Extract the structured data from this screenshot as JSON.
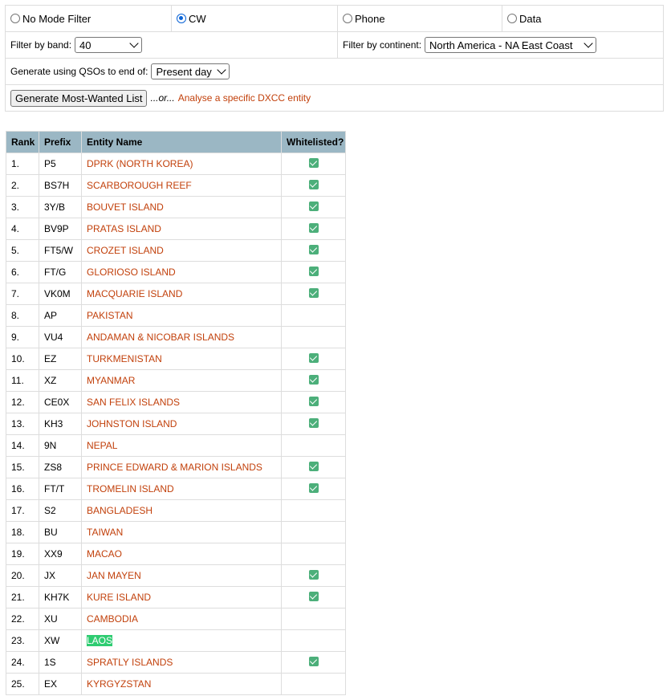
{
  "mode_filter": {
    "options": [
      {
        "label": "No Mode Filter",
        "checked": false
      },
      {
        "label": "CW",
        "checked": true
      },
      {
        "label": "Phone",
        "checked": false
      },
      {
        "label": "Data",
        "checked": false
      }
    ]
  },
  "band_filter": {
    "label": "Filter by band:",
    "value": "40"
  },
  "continent_filter": {
    "label": "Filter by continent:",
    "value": "North America - NA East Coast"
  },
  "date_filter": {
    "label": "Generate using QSOs to end of:",
    "value": "Present day"
  },
  "actions": {
    "generate_label": "Generate Most-Wanted List",
    "or_text": "...or...",
    "analyse_link": "Analyse a specific DXCC entity"
  },
  "table": {
    "headers": [
      "Rank",
      "Prefix",
      "Entity Name",
      "Whitelisted?"
    ],
    "rows": [
      {
        "rank": "1.",
        "prefix": "P5",
        "entity": "DPRK (NORTH KOREA)",
        "whitelisted": true
      },
      {
        "rank": "2.",
        "prefix": "BS7H",
        "entity": "SCARBOROUGH REEF",
        "whitelisted": true
      },
      {
        "rank": "3.",
        "prefix": "3Y/B",
        "entity": "BOUVET ISLAND",
        "whitelisted": true
      },
      {
        "rank": "4.",
        "prefix": "BV9P",
        "entity": "PRATAS ISLAND",
        "whitelisted": true
      },
      {
        "rank": "5.",
        "prefix": "FT5/W",
        "entity": "CROZET ISLAND",
        "whitelisted": true
      },
      {
        "rank": "6.",
        "prefix": "FT/G",
        "entity": "GLORIOSO ISLAND",
        "whitelisted": true
      },
      {
        "rank": "7.",
        "prefix": "VK0M",
        "entity": "MACQUARIE ISLAND",
        "whitelisted": true
      },
      {
        "rank": "8.",
        "prefix": "AP",
        "entity": "PAKISTAN",
        "whitelisted": false
      },
      {
        "rank": "9.",
        "prefix": "VU4",
        "entity": "ANDAMAN & NICOBAR ISLANDS",
        "whitelisted": false
      },
      {
        "rank": "10.",
        "prefix": "EZ",
        "entity": "TURKMENISTAN",
        "whitelisted": true
      },
      {
        "rank": "11.",
        "prefix": "XZ",
        "entity": "MYANMAR",
        "whitelisted": true
      },
      {
        "rank": "12.",
        "prefix": "CE0X",
        "entity": "SAN FELIX ISLANDS",
        "whitelisted": true
      },
      {
        "rank": "13.",
        "prefix": "KH3",
        "entity": "JOHNSTON ISLAND",
        "whitelisted": true
      },
      {
        "rank": "14.",
        "prefix": "9N",
        "entity": "NEPAL",
        "whitelisted": false
      },
      {
        "rank": "15.",
        "prefix": "ZS8",
        "entity": "PRINCE EDWARD & MARION ISLANDS",
        "whitelisted": true
      },
      {
        "rank": "16.",
        "prefix": "FT/T",
        "entity": "TROMELIN ISLAND",
        "whitelisted": true
      },
      {
        "rank": "17.",
        "prefix": "S2",
        "entity": "BANGLADESH",
        "whitelisted": false
      },
      {
        "rank": "18.",
        "prefix": "BU",
        "entity": "TAIWAN",
        "whitelisted": false
      },
      {
        "rank": "19.",
        "prefix": "XX9",
        "entity": "MACAO",
        "whitelisted": false
      },
      {
        "rank": "20.",
        "prefix": "JX",
        "entity": "JAN MAYEN",
        "whitelisted": true
      },
      {
        "rank": "21.",
        "prefix": "KH7K",
        "entity": "KURE ISLAND",
        "whitelisted": true
      },
      {
        "rank": "22.",
        "prefix": "XU",
        "entity": "CAMBODIA",
        "whitelisted": false
      },
      {
        "rank": "23.",
        "prefix": "XW",
        "entity": "LAOS",
        "whitelisted": false,
        "highlighted": true
      },
      {
        "rank": "24.",
        "prefix": "1S",
        "entity": "SPRATLY ISLANDS",
        "whitelisted": true
      },
      {
        "rank": "25.",
        "prefix": "EX",
        "entity": "KYRGYZSTAN",
        "whitelisted": false
      }
    ]
  },
  "colors": {
    "link": "#c2410c",
    "header_bg": "#9bb7c4",
    "check": "#4caf7a",
    "highlight": "#2ecc71"
  }
}
